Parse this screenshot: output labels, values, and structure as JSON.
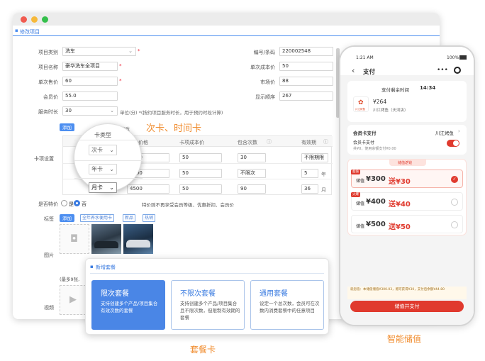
{
  "editor": {
    "section_title": "修改项目",
    "fields": {
      "category_label": "项目类别",
      "category_value": "洗车",
      "name_label": "项目名称",
      "name_value": "豪华洗车全项目",
      "price_label": "单次售价",
      "price_value": "60",
      "member_label": "会员价",
      "member_value": "55.0",
      "duration_label": "服务时长",
      "duration_value": "30",
      "duration_hint": "单位(分) *(按约项目服务时长，用于预约时段计算)",
      "code_label": "编号/条码",
      "code_value": "220002548",
      "cost_label": "单次成本价",
      "cost_value": "50",
      "market_label": "市场价",
      "market_value": "88",
      "order_label": "显示顺序",
      "order_value": "267"
    },
    "card_settings": {
      "label": "卡项设置",
      "add_label": "添加",
      "note": "卡和进行修改",
      "columns": [
        "卡类型",
        "卡项价格",
        "卡项成本价",
        "包含次数",
        "有效期"
      ],
      "rows": [
        {
          "type": "次卡",
          "price": "1000",
          "cost": "50",
          "count": "30",
          "validity": "不限期限",
          "unit": ""
        },
        {
          "type": "年卡",
          "price": "3000",
          "cost": "50",
          "count": "不限次",
          "validity": "5",
          "unit": "年"
        },
        {
          "type": "月卡",
          "price": "4500",
          "cost": "50",
          "count": "90",
          "validity": "36",
          "unit": "月"
        }
      ]
    },
    "special": {
      "label": "是否特价",
      "opt_no": "是",
      "opt_yes": "否",
      "hint": "特价则不再享受会员等级、优惠折扣、会员价"
    },
    "tags": {
      "label": "标签",
      "add_label": "添加",
      "items": [
        "全年养水便用卡",
        "新品",
        "热销"
      ]
    },
    "pictures_label": "图片",
    "video_label": "视频",
    "max_hint": "(最多9张,"
  },
  "callout_cards": "次卡、时间卡",
  "package_popup": {
    "title": "新增套餐",
    "packages": [
      {
        "name": "限次套餐",
        "desc": "支持创建多个产品/项目集合有效次数的套餐"
      },
      {
        "name": "不限次套餐",
        "desc": "支持创建多个产品/项目集合且不限次数，但限制有效期的套餐"
      },
      {
        "name": "通用套餐",
        "desc": "设定一个总次数，会员可在次数内消费套餐中的任意项目"
      }
    ]
  },
  "package_caption": "套餐卡",
  "phone": {
    "status_time": "1:21 AM",
    "battery": "100%",
    "title": "支付",
    "countdown_label": "支付剩余时间",
    "countdown_value": "14:34",
    "amount": "¥264",
    "store": "川江烤鱼（天河店）",
    "logo_text": "川江烤鱼",
    "member_pay_label": "会员卡支付",
    "member_store": "川江烤鱼",
    "member_card_label": "会员卡支付",
    "member_card_sub": "共¥0，使用余额支付¥0.00",
    "recharge_label": "储值返钱",
    "options": [
      {
        "badge": "超值",
        "label": "储值",
        "price": "¥300",
        "bonus": "送¥30",
        "selected": true
      },
      {
        "badge": "火爆",
        "label": "储值",
        "price": "¥400",
        "bonus": "送¥40",
        "selected": false
      },
      {
        "badge": "",
        "label": "储值",
        "price": "¥500",
        "bonus": "送¥50",
        "selected": false
      }
    ],
    "footer_note": "就您值：本储值储值¥300.03，赠可获得¥30，支付后余额¥44.80",
    "pay_button": "储值并支付"
  },
  "phone_caption": "智能储值"
}
